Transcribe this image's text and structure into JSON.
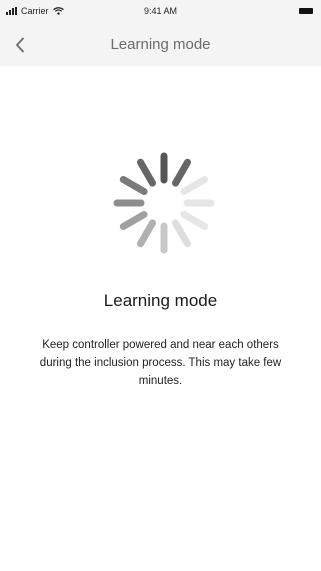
{
  "status_bar": {
    "carrier": "Carrier",
    "time": "9:41 AM",
    "icons": [
      "signal-icon",
      "wifi-icon",
      "battery-icon"
    ]
  },
  "nav": {
    "title": "Learning mode",
    "back_icon": "chevron-left-icon"
  },
  "main": {
    "spinner_icon": "loading-spinner-icon",
    "heading": "Learning mode",
    "description": "Keep controller powered and near each others during the inclusion process. This may take few minutes."
  },
  "colors": {
    "bar_background": "#f4f4f4",
    "title_gray": "#6b6b6b",
    "text_dark": "#1a1a1a"
  }
}
